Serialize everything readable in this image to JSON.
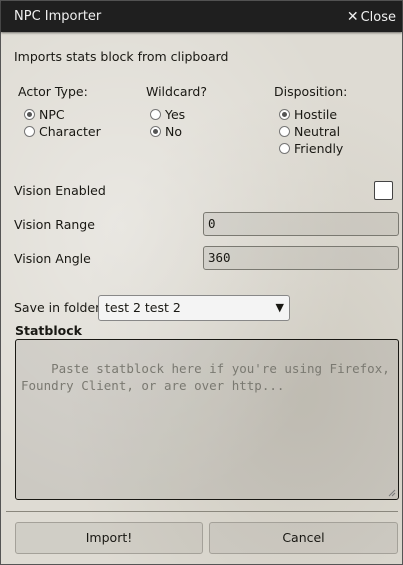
{
  "window": {
    "title": "NPC Importer",
    "close_label": "Close"
  },
  "intro": "Imports stats block from clipboard",
  "actor_type": {
    "label": "Actor Type:",
    "options": [
      {
        "label": "NPC",
        "checked": true
      },
      {
        "label": "Character",
        "checked": false
      }
    ]
  },
  "wildcard": {
    "label": "Wildcard?",
    "options": [
      {
        "label": "Yes",
        "checked": false
      },
      {
        "label": "No",
        "checked": true
      }
    ]
  },
  "disposition": {
    "label": "Disposition:",
    "options": [
      {
        "label": "Hostile",
        "checked": true
      },
      {
        "label": "Neutral",
        "checked": false
      },
      {
        "label": "Friendly",
        "checked": false
      }
    ]
  },
  "vision_enabled": {
    "label": "Vision Enabled",
    "checked": false
  },
  "vision_range": {
    "label": "Vision Range",
    "value": "0"
  },
  "vision_angle": {
    "label": "Vision Angle",
    "value": "360"
  },
  "save_folder": {
    "label": "Save in folder",
    "selected": "test 2 test 2"
  },
  "statblock": {
    "label": "Statblock",
    "placeholder": "Paste statblock here if you're using Firefox, Foundry Client, or are over http..."
  },
  "buttons": {
    "import": "Import!",
    "cancel": "Cancel"
  },
  "icons": {
    "close": "close-icon",
    "dropdown": "chevron-down-icon"
  }
}
